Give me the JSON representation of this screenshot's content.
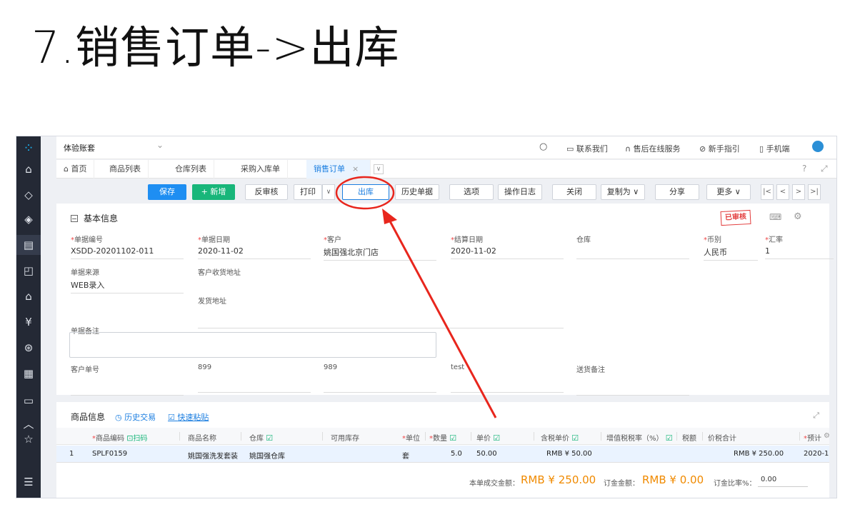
{
  "slide_title": "7.销售订单->出库",
  "topbar": {
    "account": "体验账套",
    "contact": "联系我们",
    "service": "售后在线服务",
    "guide": "新手指引",
    "mobile": "手机端"
  },
  "tabs": [
    {
      "label": "首页"
    },
    {
      "label": "商品列表"
    },
    {
      "label": "仓库列表"
    },
    {
      "label": "采购入库单"
    },
    {
      "label": "销售订单",
      "active": true
    }
  ],
  "toolbar": {
    "save": "保存",
    "add": "+ 新增",
    "unaudit": "反审核",
    "print": "打印",
    "outbound": "出库",
    "history": "历史单据",
    "options": "选项",
    "log": "操作日志",
    "close": "关闭",
    "copy_as": "复制为",
    "share": "分享",
    "more": "更多"
  },
  "basic_info": {
    "section_title": "基本信息",
    "stamp": "已审核",
    "fields": {
      "doc_no": {
        "label": "单据编号",
        "value": "XSDD-20201102-011"
      },
      "doc_date": {
        "label": "单据日期",
        "value": "2020-11-02"
      },
      "customer": {
        "label": "客户",
        "value": "姚国强北京门店"
      },
      "settle_date": {
        "label": "结算日期",
        "value": "2020-11-02"
      },
      "warehouse": {
        "label": "仓库",
        "value": ""
      },
      "currency": {
        "label": "币别",
        "value": "人民币"
      },
      "rate": {
        "label": "汇率",
        "value": "1"
      },
      "source": {
        "label": "单据来源",
        "value": "WEB录入"
      },
      "receive_addr": {
        "label": "客户收货地址",
        "value": ""
      },
      "ship_addr": {
        "label": "发货地址",
        "value": ""
      },
      "remark": {
        "label": "单据备注",
        "value": ""
      },
      "customer_no": {
        "label": "客户单号",
        "value": ""
      },
      "custom1": "899",
      "custom2": "989",
      "custom3": "test",
      "delivery_remark": {
        "label": "送货备注",
        "value": ""
      }
    }
  },
  "goods": {
    "title": "商品信息",
    "history_link": "历史交易",
    "paste_link": "快速粘贴",
    "headers": {
      "code": "商品编码",
      "scan": "扫码",
      "name": "商品名称",
      "warehouse": "仓库",
      "stock": "可用库存",
      "unit": "单位",
      "qty": "数量",
      "price": "单价",
      "tax_price": "含税单价",
      "vat": "增值税税率（%）",
      "tax": "税额",
      "total": "价税合计",
      "expected": "预计"
    },
    "rows": [
      {
        "no": "1",
        "code": "SPLF0159",
        "name": "姚国强洗发套装",
        "warehouse": "姚国强仓库",
        "unit": "套",
        "qty": "5.0",
        "price": "50.00",
        "tax_price": "RMB ¥ 50.00",
        "total": "RMB ¥ 250.00",
        "expected": "2020-1"
      }
    ],
    "footer": {
      "amount_label": "本单成交金额：",
      "amount": "RMB ¥ 250.00",
      "deposit_label": "订金金额：",
      "deposit": "RMB ¥ 0.00",
      "ratio_label": "订金比率%：",
      "ratio": "0.00"
    }
  },
  "colors": {
    "sidebar": "#242935",
    "primary": "#1e8ef2",
    "success": "#18b67a",
    "annotation": "#e8261d",
    "amount": "#f08a00"
  }
}
